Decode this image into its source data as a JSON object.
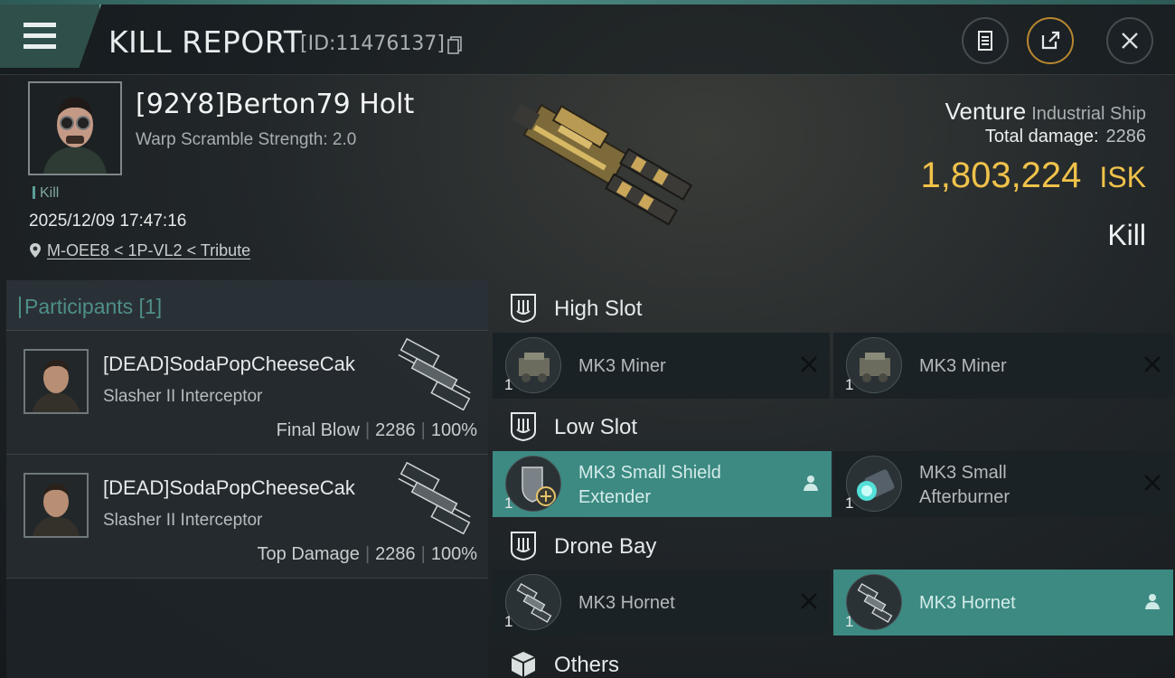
{
  "header": {
    "title": "KILL REPORT",
    "report_id": "[ID:11476137]"
  },
  "victim": {
    "pilot": "[92Y8]Berton79 Holt",
    "warp_scramble": "Warp Scramble Strength: 2.0",
    "tag": "Kill",
    "timestamp": "2025/12/09 17:47:16",
    "location": "M-OEE8 < 1P-VL2 < Tribute",
    "ship_name": "Venture",
    "ship_class": "Industrial Ship",
    "total_damage_label": "Total damage:",
    "total_damage": "2286",
    "isk_value": "1,803,224",
    "isk_unit": "ISK",
    "result": "Kill"
  },
  "participants": {
    "label": "Participants [1]",
    "rows": [
      {
        "name": "[DEAD]SodaPopCheeseCak",
        "ship": "Slasher II Interceptor",
        "role": "Final Blow",
        "damage": "2286",
        "percent": "100%"
      },
      {
        "name": "[DEAD]SodaPopCheeseCak",
        "ship": "Slasher II Interceptor",
        "role": "Top Damage",
        "damage": "2286",
        "percent": "100%"
      }
    ]
  },
  "fittings": {
    "high_slot": {
      "title": "High Slot",
      "items": [
        {
          "name": "MK3 Miner",
          "qty": "1",
          "status": "destroyed"
        },
        {
          "name": "MK3 Miner",
          "qty": "1",
          "status": "destroyed"
        }
      ]
    },
    "low_slot": {
      "title": "Low Slot",
      "items": [
        {
          "name_line1": "MK3 Small Shield",
          "name_line2": "Extender",
          "qty": "1",
          "status": "dropped"
        },
        {
          "name_line1": "MK3 Small",
          "name_line2": "Afterburner",
          "qty": "1",
          "status": "destroyed"
        }
      ]
    },
    "drone_bay": {
      "title": "Drone Bay",
      "items": [
        {
          "name": "MK3  Hornet",
          "qty": "1",
          "status": "destroyed"
        },
        {
          "name": "MK3  Hornet",
          "qty": "1",
          "status": "dropped"
        }
      ]
    },
    "others": {
      "title": "Others"
    }
  },
  "colors": {
    "accent": "#3c8a82",
    "isk": "#f0c24a",
    "header_tab": "#2f4f4b"
  }
}
